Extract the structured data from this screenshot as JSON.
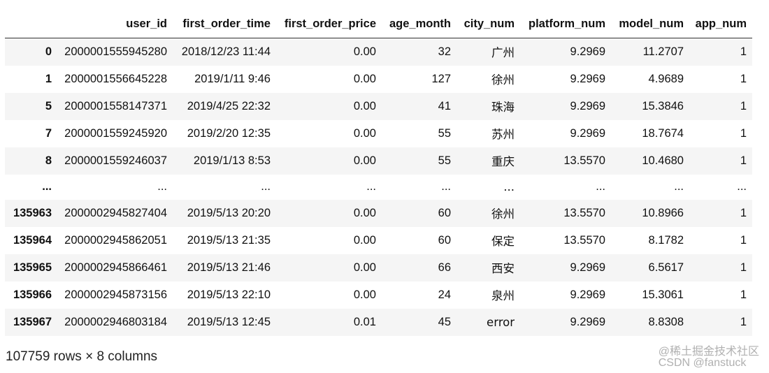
{
  "table": {
    "columns": [
      "",
      "user_id",
      "first_order_time",
      "first_order_price",
      "age_month",
      "city_num",
      "platform_num",
      "model_num",
      "app_num"
    ],
    "rows": [
      [
        "0",
        "2000001555945280",
        "2018/12/23 11:44",
        "0.00",
        "32",
        "广州",
        "9.2969",
        "11.2707",
        "1"
      ],
      [
        "1",
        "2000001556645228",
        "2019/1/11 9:46",
        "0.00",
        "127",
        "徐州",
        "9.2969",
        "4.9689",
        "1"
      ],
      [
        "5",
        "2000001558147371",
        "2019/4/25 22:32",
        "0.00",
        "41",
        "珠海",
        "9.2969",
        "15.3846",
        "1"
      ],
      [
        "7",
        "2000001559245920",
        "2019/2/20 12:35",
        "0.00",
        "55",
        "苏州",
        "9.2969",
        "18.7674",
        "1"
      ],
      [
        "8",
        "2000001559246037",
        "2019/1/13 8:53",
        "0.00",
        "55",
        "重庆",
        "13.5570",
        "10.4680",
        "1"
      ],
      [
        "...",
        "...",
        "...",
        "...",
        "...",
        "...",
        "...",
        "...",
        "..."
      ],
      [
        "135963",
        "2000002945827404",
        "2019/5/13 20:20",
        "0.00",
        "60",
        "徐州",
        "13.5570",
        "10.8966",
        "1"
      ],
      [
        "135964",
        "2000002945862051",
        "2019/5/13 21:35",
        "0.00",
        "60",
        "保定",
        "13.5570",
        "8.1782",
        "1"
      ],
      [
        "135965",
        "2000002945866461",
        "2019/5/13 21:46",
        "0.00",
        "66",
        "西安",
        "9.2969",
        "6.5617",
        "1"
      ],
      [
        "135966",
        "2000002945873156",
        "2019/5/13 22:10",
        "0.00",
        "24",
        "泉州",
        "9.2969",
        "15.3061",
        "1"
      ],
      [
        "135967",
        "2000002946803184",
        "2019/5/13 12:45",
        "0.01",
        "45",
        "error",
        "9.2969",
        "8.8308",
        "1"
      ]
    ]
  },
  "footer": {
    "shape_text": "107759 rows × 8 columns"
  },
  "watermark": {
    "line1": "@稀土掘金技术社区",
    "line2": "CSDN @fanstuck"
  }
}
